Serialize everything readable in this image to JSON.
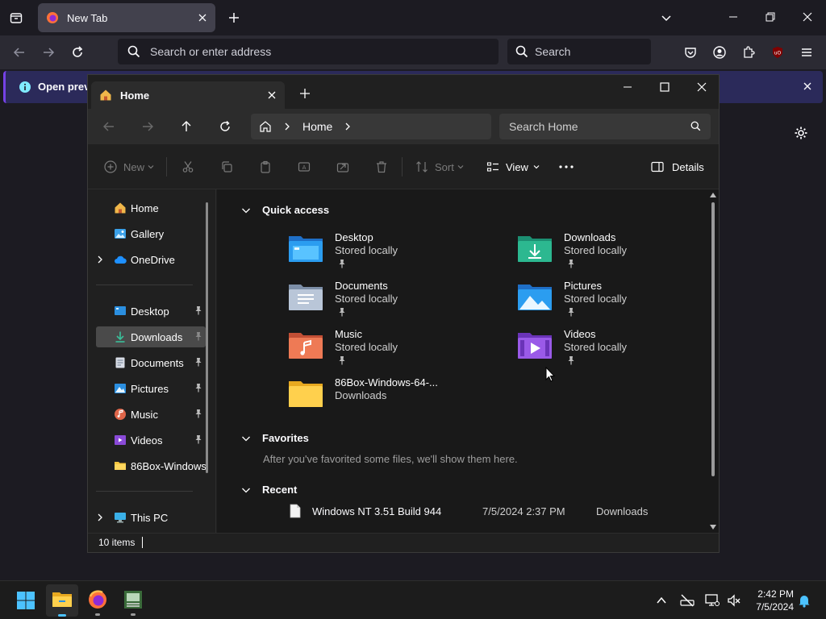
{
  "browser": {
    "tab_title": "New Tab",
    "url_placeholder": "Search or enter address",
    "search_placeholder": "Search",
    "notice_text": "Open previo"
  },
  "explorer": {
    "tab_title": "Home",
    "breadcrumb": "Home",
    "search_placeholder": "Search Home",
    "toolbar": {
      "new_label": "New",
      "sort_label": "Sort",
      "view_label": "View",
      "details_label": "Details"
    },
    "sidebar": {
      "home": "Home",
      "gallery": "Gallery",
      "onedrive": "OneDrive",
      "desktop": "Desktop",
      "downloads": "Downloads",
      "documents": "Documents",
      "pictures": "Pictures",
      "music": "Music",
      "videos": "Videos",
      "box": "86Box-Windows",
      "thispc": "This PC"
    },
    "quick_access": {
      "title": "Quick access",
      "items": [
        {
          "name": "Desktop",
          "sub": "Stored locally"
        },
        {
          "name": "Downloads",
          "sub": "Stored locally"
        },
        {
          "name": "Documents",
          "sub": "Stored locally"
        },
        {
          "name": "Pictures",
          "sub": "Stored locally"
        },
        {
          "name": "Music",
          "sub": "Stored locally"
        },
        {
          "name": "Videos",
          "sub": "Stored locally"
        },
        {
          "name": "86Box-Windows-64-...",
          "sub": "Downloads"
        }
      ]
    },
    "favorites": {
      "title": "Favorites",
      "empty": "After you've favorited some files, we'll show them here."
    },
    "recent": {
      "title": "Recent",
      "items": [
        {
          "name": "Windows NT  3.51 Build 944",
          "date": "7/5/2024 2:37 PM",
          "location": "Downloads"
        }
      ]
    },
    "status": "10 items"
  },
  "taskbar": {
    "time": "2:42 PM",
    "date": "7/5/2024"
  }
}
